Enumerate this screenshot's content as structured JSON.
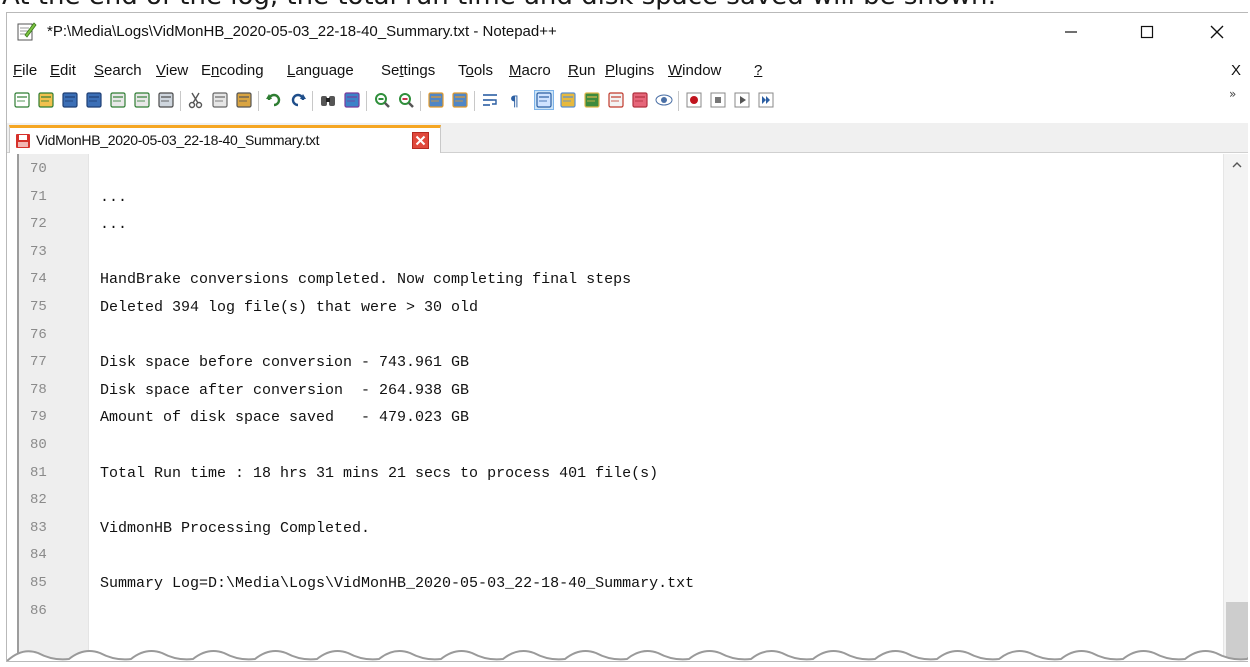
{
  "caption": "At the end of the log, the total run time and disk space saved will be shown:",
  "window": {
    "title": "*P:\\Media\\Logs\\VidMonHB_2020-05-03_22-18-40_Summary.txt - Notepad++",
    "minimize_icon": "minimize-icon",
    "maximize_icon": "maximize-icon",
    "close_icon": "close-icon"
  },
  "menu": {
    "items": [
      {
        "underline": "F",
        "rest": "ile"
      },
      {
        "underline": "E",
        "rest": "dit"
      },
      {
        "underline": "S",
        "rest": "earch"
      },
      {
        "underline": "V",
        "rest": "iew"
      },
      {
        "pre": "E",
        "underline": "n",
        "rest": "coding"
      },
      {
        "underline": "L",
        "rest": "anguage"
      },
      {
        "pre": "Se",
        "underline": "t",
        "rest": "tings"
      },
      {
        "pre": "T",
        "underline": "o",
        "rest": "ols"
      },
      {
        "underline": "M",
        "rest": "acro"
      },
      {
        "underline": "R",
        "rest": "un"
      },
      {
        "underline": "P",
        "rest": "lugins"
      },
      {
        "underline": "W",
        "rest": "indow"
      },
      {
        "underline": "?",
        "rest": ""
      }
    ],
    "close_doc": "X"
  },
  "toolbar": {
    "more": "»",
    "icons": [
      "new-file-icon",
      "open-file-icon",
      "save-icon",
      "save-all-icon",
      "close-file-icon",
      "close-all-icon",
      "print-icon",
      "cut-icon",
      "copy-icon",
      "paste-icon",
      "undo-icon",
      "redo-icon",
      "find-icon",
      "replace-icon",
      "zoom-in-icon",
      "zoom-out-icon",
      "sync-vertical-icon",
      "sync-horizontal-icon",
      "word-wrap-icon",
      "show-all-characters-icon",
      "indent-guide-icon",
      "user-defined-language-icon",
      "document-map-icon",
      "function-list-icon",
      "folder-as-workspace-icon",
      "monitoring-icon",
      "record-macro-icon",
      "stop-recording-icon",
      "playback-macro-icon",
      "run-macro-multiple-icon"
    ]
  },
  "tab": {
    "label": "VidMonHB_2020-05-03_22-18-40_Summary.txt"
  },
  "editor": {
    "lines": [
      {
        "num": "70",
        "text": ""
      },
      {
        "num": "71",
        "text": "..."
      },
      {
        "num": "72",
        "text": "..."
      },
      {
        "num": "73",
        "text": ""
      },
      {
        "num": "74",
        "text": "HandBrake conversions completed. Now completing final steps"
      },
      {
        "num": "75",
        "text": "Deleted 394 log file(s) that were > 30 old"
      },
      {
        "num": "76",
        "text": ""
      },
      {
        "num": "77",
        "text": "Disk space before conversion - 743.961 GB"
      },
      {
        "num": "78",
        "text": "Disk space after conversion  - 264.938 GB"
      },
      {
        "num": "79",
        "text": "Amount of disk space saved   - 479.023 GB"
      },
      {
        "num": "80",
        "text": ""
      },
      {
        "num": "81",
        "text": "Total Run time : 18 hrs 31 mins 21 secs to process 401 file(s)"
      },
      {
        "num": "82",
        "text": ""
      },
      {
        "num": "83",
        "text": "VidmonHB Processing Completed."
      },
      {
        "num": "84",
        "text": ""
      },
      {
        "num": "85",
        "text": "Summary Log=D:\\Media\\Logs\\VidMonHB_2020-05-03_22-18-40_Summary.txt"
      },
      {
        "num": "86",
        "text": ""
      }
    ]
  }
}
